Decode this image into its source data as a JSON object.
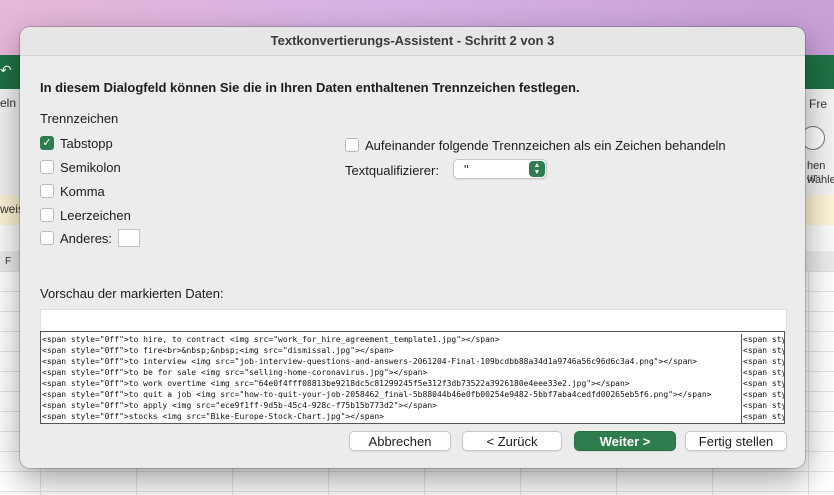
{
  "background": {
    "left_texts": [
      "eln",
      "weis",
      "F"
    ],
    "right_texts": [
      "Fre",
      "hen ur",
      "wähle"
    ]
  },
  "dialog": {
    "title": "Textkonvertierungs-Assistent - Schritt 2 von 3",
    "instruction": "In diesem Dialogfeld können Sie die in Ihren Daten enthaltenen Trennzeichen festlegen.",
    "delimiters_label": "Trennzeichen",
    "delimiters": [
      {
        "label": "Tabstopp",
        "checked": true
      },
      {
        "label": "Semikolon",
        "checked": false
      },
      {
        "label": "Komma",
        "checked": false
      },
      {
        "label": "Leerzeichen",
        "checked": false
      },
      {
        "label": "Anderes:",
        "checked": false
      }
    ],
    "consecutive_label": "Aufeinander folgende Trennzeichen als ein Zeichen behandeln",
    "consecutive_checked": false,
    "text_qualifier_label": "Textqualifizierer:",
    "text_qualifier_value": "\"",
    "preview_label": "Vorschau der markierten Daten:",
    "preview_lines": [
      "<span style=\"0ff\">to hire, to contract <img src=\"work_for_hire_agreement_template1.jpg\"></span>",
      "<span style=\"0ff\">to fire<br>&nbsp;&nbsp;<img src=\"dismissal.jpg\"></span>",
      "<span style=\"0ff\">to interview <img src=\"job-interview-questions-and-answers-2061204-Final-109bcdbb88a34d1a9746a56c96d6c3a4.png\"></span>",
      "<span style=\"0ff\">to be for sale <img src=\"selling-home-coronavirus.jpg\"></span>",
      "<span style=\"0ff\">to work overtime <img src=\"64e0f4fff08813be9218dc5c81299245f5e312f3db73522a3926180e4eee33e2.jpg\"></span>",
      "<span style=\"0ff\">to quit a job <img src=\"how-to-quit-your-job-2058462_final-5b88044b46e0fb00254e9482-5bbf7aba4cedfd00265eb5f6.png\"></span>",
      "<span style=\"0ff\">to apply <img src=\"ece9f1ff-9d5b-45c4-928c-f75b15b773d2\"></span>",
      "<span style=\"0ff\">stocks <img src=\"Bike-Europe-Stock-Chart.jpg\"></span>"
    ],
    "preview_side_lines": [
      "<span sty",
      "<span sty",
      "<span sty",
      "<span sty",
      "<span sty",
      "<span sty",
      "<span sty",
      "<span sty"
    ],
    "buttons": {
      "cancel": "Abbrechen",
      "back": "< Zurück",
      "next": "Weiter >",
      "finish": "Fertig stellen"
    }
  },
  "colors": {
    "accent": "#2e7d4f",
    "excel_green": "#1f7246"
  }
}
